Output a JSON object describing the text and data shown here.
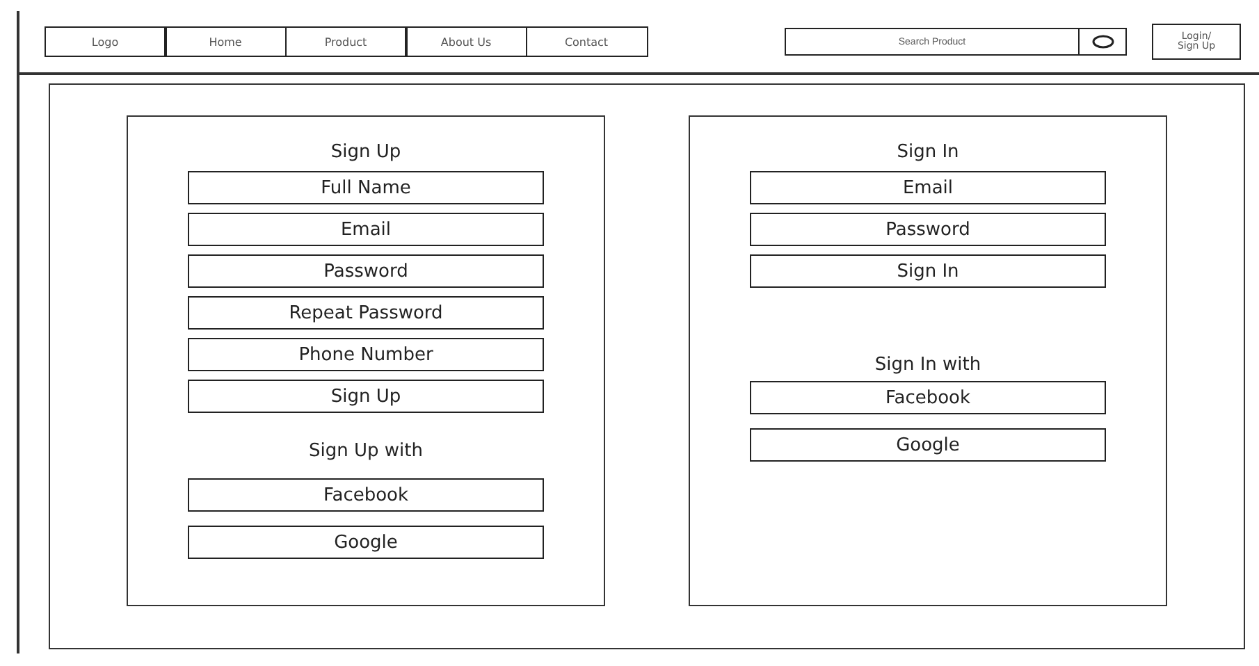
{
  "nav": {
    "items": [
      {
        "label": "Logo"
      },
      {
        "label": "Home"
      },
      {
        "label": "Product"
      },
      {
        "label": "About Us"
      },
      {
        "label": "Contact"
      }
    ],
    "search": {
      "placeholder": "Search Product"
    },
    "login": "Login/ Sign Up"
  },
  "sign_up": {
    "title": "Sign Up",
    "items": [
      "Full Name",
      "Email",
      "Password",
      "Repeat Password",
      "Phone Number",
      "Sign Up"
    ],
    "social_title": "Sign Up with",
    "social": [
      "Facebook",
      "Google"
    ]
  },
  "sign_in": {
    "title": "Sign In",
    "items": [
      "Email",
      "Password",
      "Sign In"
    ],
    "social_title": "Sign In with",
    "social": [
      "Facebook",
      "Google"
    ]
  }
}
